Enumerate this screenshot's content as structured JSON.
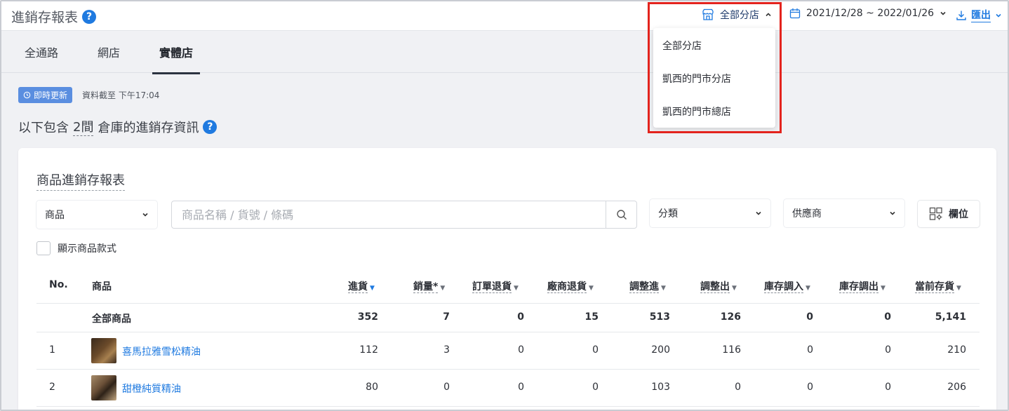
{
  "header": {
    "title": "進銷存報表",
    "help_symbol": "?",
    "store_selector": "全部分店",
    "date_range": "2021/12/28 ~ 2022/01/26",
    "export_label": "匯出"
  },
  "tabs": [
    {
      "label": "全通路"
    },
    {
      "label": "網店"
    },
    {
      "label": "實體店",
      "active": true
    }
  ],
  "status": {
    "badge": "即時更新",
    "updated_at": "資料截至 下午17:04"
  },
  "summary": {
    "prefix": "以下包含",
    "count": "2間",
    "suffix": "倉庫的進銷存資訊"
  },
  "report": {
    "title": "商品進銷存報表",
    "filter_type": "商品",
    "search_placeholder": "商品名稱 / 貨號 / 條碼",
    "category_placeholder": "分類",
    "supplier_placeholder": "供應商",
    "columns_button": "欄位",
    "show_variants_label": "顯示商品款式"
  },
  "table": {
    "headers": [
      "No.",
      "商品",
      "進貨",
      "銷量*",
      "訂單退貨",
      "廠商退貨",
      "調整進",
      "調整出",
      "庫存調入",
      "庫存調出",
      "當前存貨"
    ],
    "total_row": {
      "label": "全部商品",
      "values": [
        "352",
        "7",
        "0",
        "15",
        "513",
        "126",
        "0",
        "0",
        "5,141"
      ]
    },
    "rows": [
      {
        "no": "1",
        "name": "喜馬拉雅雪松精油",
        "values": [
          "112",
          "3",
          "0",
          "0",
          "200",
          "116",
          "0",
          "0",
          "210"
        ]
      },
      {
        "no": "2",
        "name": "甜橙純質精油",
        "values": [
          "80",
          "0",
          "0",
          "0",
          "103",
          "0",
          "0",
          "0",
          "206"
        ]
      }
    ]
  },
  "store_dropdown": {
    "options": [
      "全部分店",
      "凱西的門市分店",
      "凱西的門市總店"
    ]
  },
  "colors": {
    "accent": "#1f7ae0",
    "highlight": "#e3231d",
    "badge": "#5a8ee0"
  }
}
